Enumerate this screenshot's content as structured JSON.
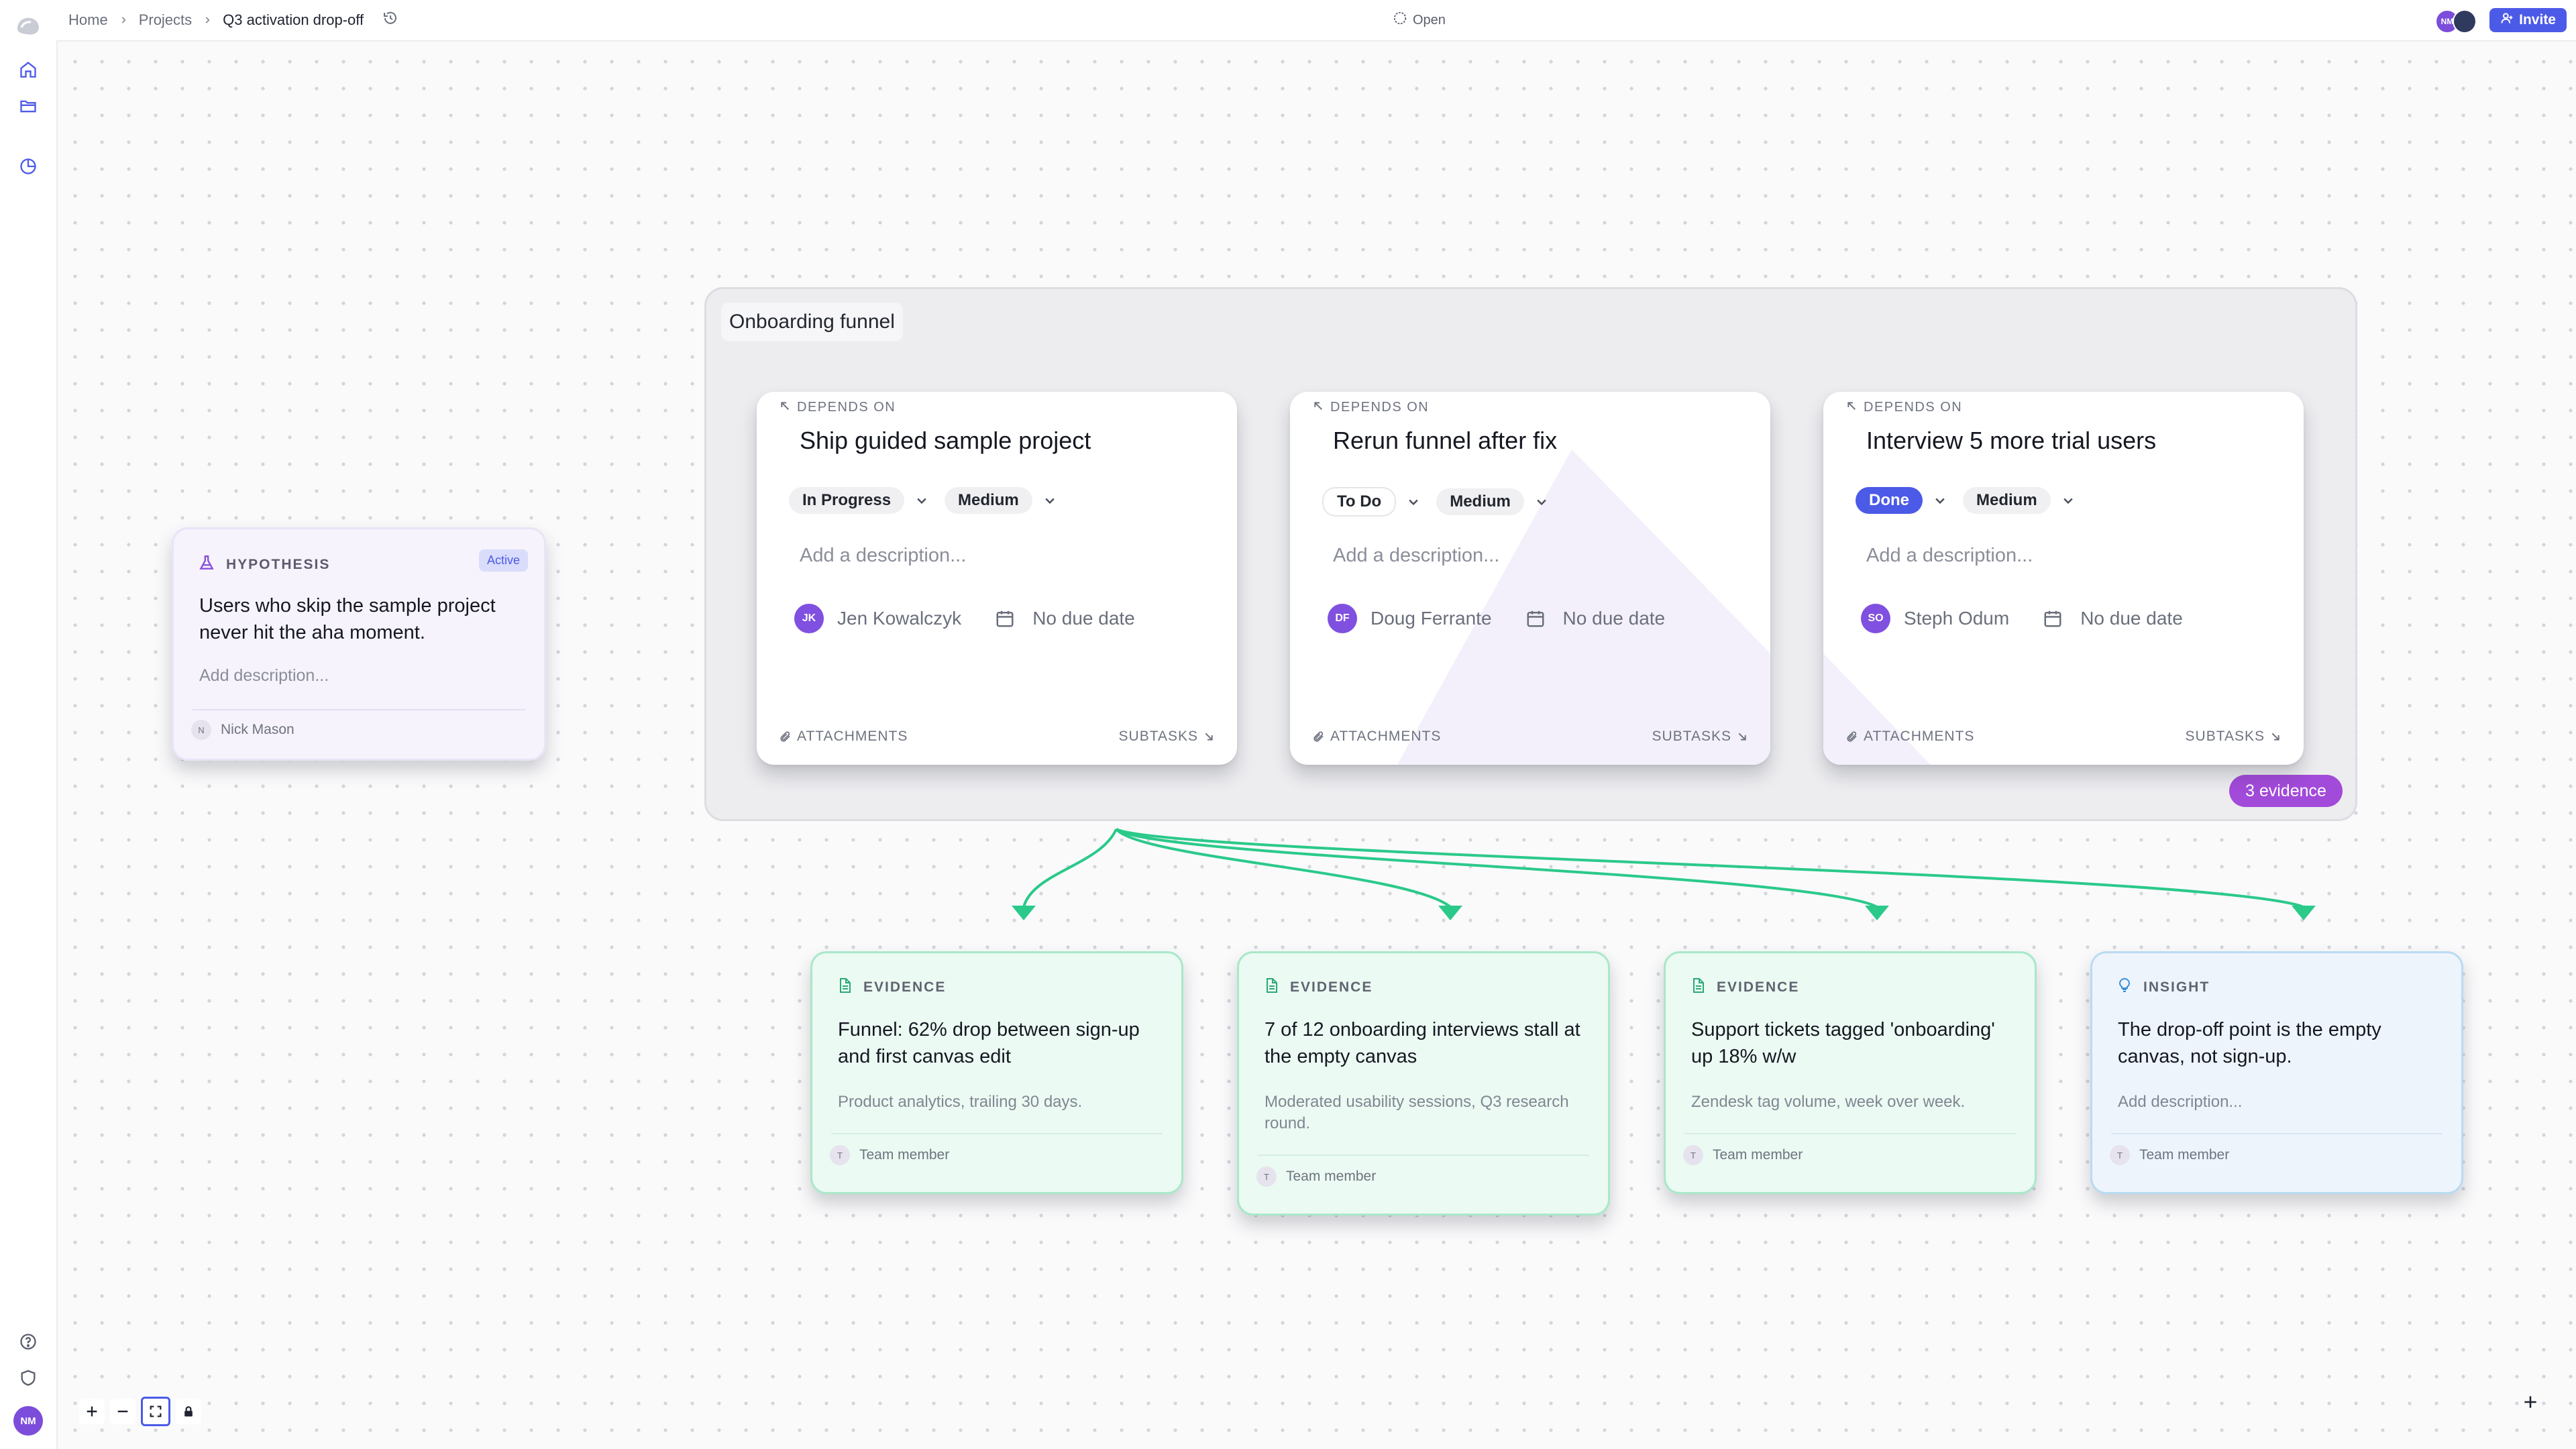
{
  "breadcrumb": {
    "home": "Home",
    "projects": "Projects",
    "current": "Q3 activation drop-off"
  },
  "topbar": {
    "status": "Open",
    "invite_label": "Invite",
    "presence": [
      "NM",
      ""
    ]
  },
  "sidebar": {
    "icons": [
      "logo-icon",
      "home-icon",
      "folder-icon",
      "history-icon",
      "help-icon",
      "shield-icon"
    ],
    "user_initials": "NM"
  },
  "group": {
    "title": "Onboarding funnel",
    "evidence_badge": "3 evidence"
  },
  "tasks": [
    {
      "depends_label": "DEPENDS ON",
      "title": "Ship guided sample project",
      "status": "In Progress",
      "priority": "Medium",
      "description_placeholder": "Add a description...",
      "assignee": "Jen Kowalczyk",
      "assignee_initials": "JK",
      "due": "No due date",
      "attachments_label": "ATTACHMENTS",
      "subtasks_label": "SUBTASKS"
    },
    {
      "depends_label": "DEPENDS ON",
      "title": "Rerun funnel after fix",
      "status": "To Do",
      "priority": "Medium",
      "description_placeholder": "Add a description...",
      "assignee": "Doug Ferrante",
      "assignee_initials": "DF",
      "due": "No due date",
      "attachments_label": "ATTACHMENTS",
      "subtasks_label": "SUBTASKS"
    },
    {
      "depends_label": "DEPENDS ON",
      "title": "Interview 5 more trial users",
      "status": "Done",
      "priority": "Medium",
      "description_placeholder": "Add a description...",
      "assignee": "Steph Odum",
      "assignee_initials": "SO",
      "due": "No due date",
      "attachments_label": "ATTACHMENTS",
      "subtasks_label": "SUBTASKS"
    }
  ],
  "hypothesis": {
    "type_label": "HYPOTHESIS",
    "badge": "Active",
    "title": "Users who skip the sample project never hit the aha moment.",
    "description_placeholder": "Add description...",
    "author_initial": "N",
    "author": "Nick Mason"
  },
  "evidence": [
    {
      "type_label": "EVIDENCE",
      "title": "Funnel: 62% drop between sign-up and first canvas edit",
      "description": "Product analytics, trailing 30 days.",
      "author_initial": "T",
      "author": "Team member"
    },
    {
      "type_label": "EVIDENCE",
      "title": "7 of 12 onboarding interviews stall at the empty canvas",
      "description": "Moderated usability sessions, Q3 research round.",
      "author_initial": "T",
      "author": "Team member"
    },
    {
      "type_label": "EVIDENCE",
      "title": "Support tickets tagged 'onboarding' up 18% w/w",
      "description": "Zendesk tag volume, week over week.",
      "author_initial": "T",
      "author": "Team member"
    },
    {
      "type_label": "INSIGHT",
      "title": "The drop-off point is the empty canvas, not sign-up.",
      "description": "Add description...",
      "author_initial": "T",
      "author": "Team member"
    }
  ],
  "colors": {
    "accent": "#4c5ae8",
    "evidence_badge": "#a24ad9",
    "connector": "#2bc98a",
    "evidence_bg": "#ebfaf2",
    "insight_bg": "#eef4fc",
    "hypothesis_bg": "#f6f3fc"
  }
}
